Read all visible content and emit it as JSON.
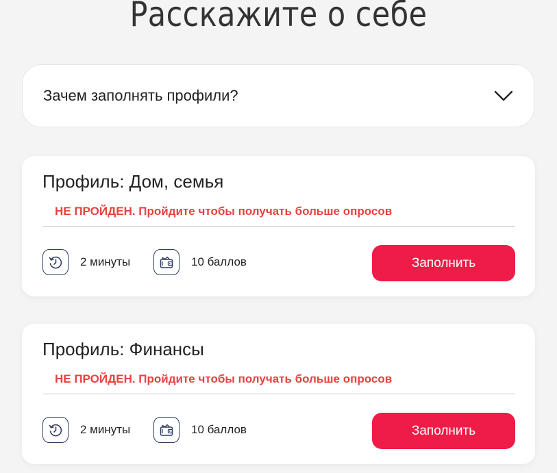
{
  "page": {
    "title": "Расскажите о себе"
  },
  "faq": {
    "label": "Зачем заполнять профили?",
    "icon": "chevron-down-icon"
  },
  "colors": {
    "background": "#f4f4f5",
    "status_red": "#e8413f",
    "button_red": "#ee1c47",
    "icon_navy": "#2f3e63"
  },
  "profiles": [
    {
      "title": "Профиль: Дом, семья",
      "status": "НЕ ПРОЙДЕН. Пройдите чтобы получать больше опросов",
      "time": "2 минуты",
      "points": "10 баллов",
      "button": "Заполнить",
      "time_icon": "clock-history-icon",
      "points_icon": "wallet-icon"
    },
    {
      "title": "Профиль: Финансы",
      "status": "НЕ ПРОЙДЕН. Пройдите чтобы получать больше опросов",
      "time": "2 минуты",
      "points": "10 баллов",
      "button": "Заполнить",
      "time_icon": "clock-history-icon",
      "points_icon": "wallet-icon"
    }
  ]
}
